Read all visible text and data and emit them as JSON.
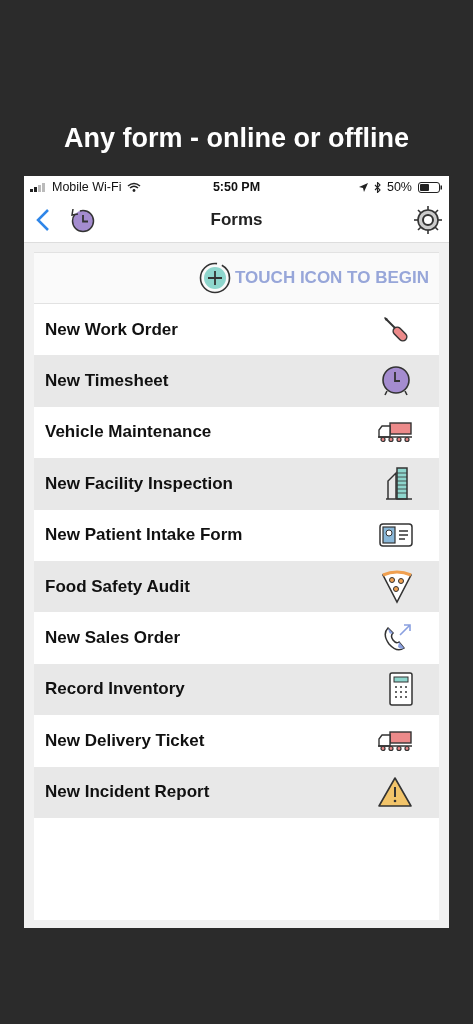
{
  "headline": "Any form - online or offline",
  "status_bar": {
    "carrier": "Mobile Wi-Fi",
    "time": "5:50 PM",
    "battery": "50%"
  },
  "nav": {
    "title": "Forms"
  },
  "prompt": "TOUCH ICON TO BEGIN",
  "forms": [
    {
      "label": "New Work Order"
    },
    {
      "label": "New Timesheet"
    },
    {
      "label": "Vehicle Maintenance"
    },
    {
      "label": "New Facility Inspection"
    },
    {
      "label": "New Patient Intake Form"
    },
    {
      "label": "Food Safety Audit"
    },
    {
      "label": "New Sales Order"
    },
    {
      "label": "Record Inventory"
    },
    {
      "label": "New Delivery Ticket"
    },
    {
      "label": "New Incident Report"
    }
  ]
}
